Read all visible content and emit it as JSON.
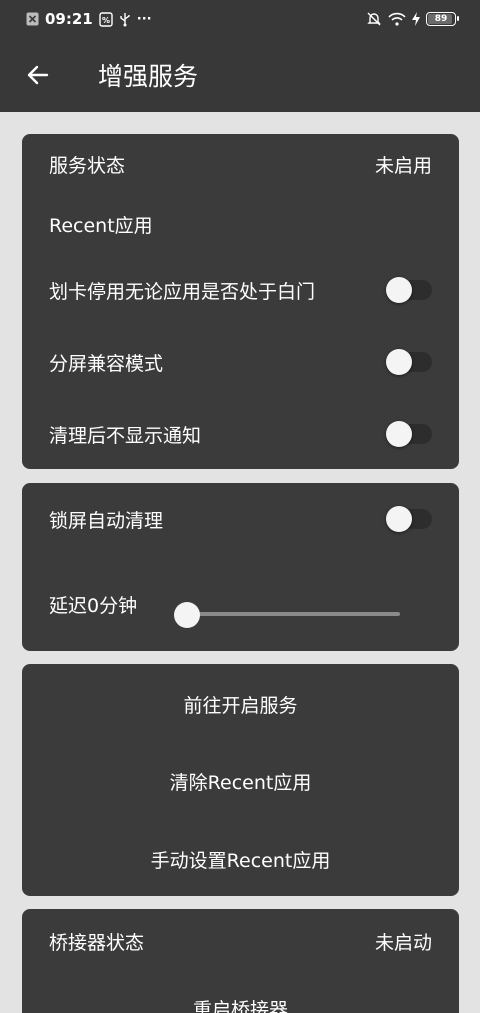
{
  "status_bar": {
    "time": "09:21",
    "extra_dots": "···",
    "battery": "89",
    "icons": [
      "close-box-icon",
      "sim-icon",
      "usb-icon",
      "mute-bell-icon",
      "wifi-icon",
      "charging-icon",
      "battery-icon"
    ]
  },
  "app_bar": {
    "title": "增强服务",
    "back_icon": "arrow-back-icon"
  },
  "service_card": {
    "status_label": "服务状态",
    "status_value": "未启用",
    "recent_label": "Recent应用",
    "toggle1_label": "划卡停用无论应用是否处于白门",
    "toggle1_on": false,
    "toggle2_label": "分屏兼容模式",
    "toggle2_on": false,
    "toggle3_label": "清理后不显示通知",
    "toggle3_on": false
  },
  "lock_card": {
    "lock_clean_label": "锁屏自动清理",
    "lock_clean_on": false,
    "delay_label": "延迟0分钟",
    "delay_value": 0
  },
  "actions_card": {
    "go_enable": "前往开启服务",
    "clear_recent": "清除Recent应用",
    "manual_recent": "手动设置Recent应用"
  },
  "bridge_card": {
    "status_label": "桥接器状态",
    "status_value": "未启动",
    "restart_label": "重启桥接器"
  }
}
